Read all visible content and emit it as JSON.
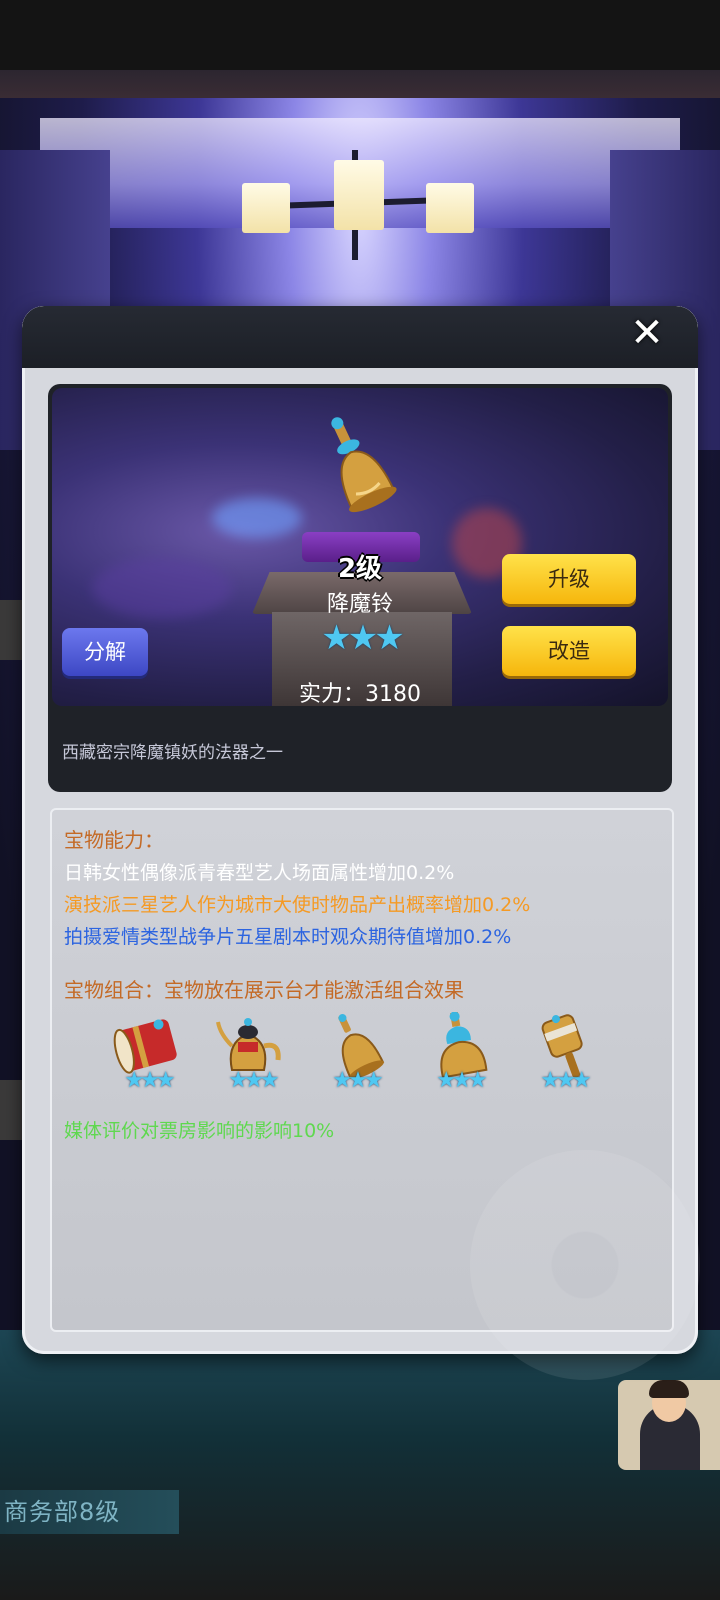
{
  "item": {
    "level": "2级",
    "name": "降魔铃",
    "stars": "★★★",
    "power": "实力：3180",
    "description": "西藏密宗降魔镇妖的法器之一"
  },
  "buttons": {
    "upgrade": "升级",
    "modify": "改造",
    "decompose": "分解",
    "close": "✕"
  },
  "ability": {
    "title": "宝物能力：",
    "lines": [
      {
        "text": "日韩女性偶像派青春型艺人场面属性增加0.2%",
        "color": "#ffffff"
      },
      {
        "text": "演技派三星艺人作为城市大使时物品产出概率增加0.2%",
        "color": "#f59a24"
      },
      {
        "text": "拍摄爱情类型战争片五星剧本时观众期待值增加0.2%",
        "color": "#2c64e0"
      }
    ]
  },
  "combo": {
    "title": "宝物组合：宝物放在展示台才能激活组合效果",
    "items": [
      {
        "icon": "drum-icon",
        "stars": "★★★"
      },
      {
        "icon": "teapot-icon",
        "stars": "★★★"
      },
      {
        "icon": "bell-icon",
        "stars": "★★★"
      },
      {
        "icon": "vase-icon",
        "stars": "★★★"
      },
      {
        "icon": "prayer-wheel-icon",
        "stars": "★★★"
      }
    ],
    "effect": "媒体评价对票房影响的影响10%"
  },
  "background": {
    "department_label": "商务部8级"
  },
  "colors": {
    "accent_yellow": "#f6c020",
    "accent_blue": "#4a56d6",
    "section_title": "#c46a26",
    "combo_effect": "#5fd84f",
    "star": "#4fc8f2"
  }
}
